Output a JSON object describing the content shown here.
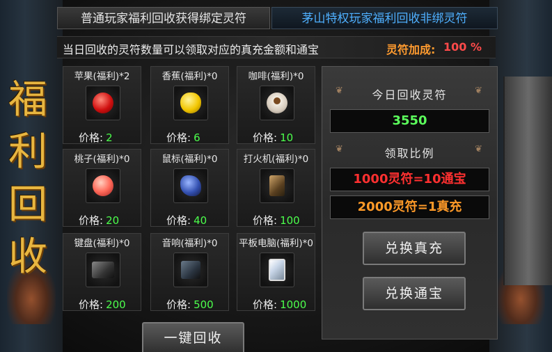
{
  "tabs": {
    "normal": "普通玩家福利回收获得绑定灵符",
    "vip": "茅山特权玩家福利回收非绑灵符"
  },
  "notice": {
    "text": "当日回收的灵符数量可以领取对应的真充金额和通宝",
    "bonus_label": "灵符加成:",
    "bonus_value": "100 %"
  },
  "side_title": [
    "福",
    "利",
    "回",
    "收"
  ],
  "price_label": "价格:",
  "items": [
    {
      "name": "苹果(福利)*2",
      "price": "2",
      "icon": "apple-icon"
    },
    {
      "name": "香蕉(福利)*0",
      "price": "6",
      "icon": "banana-icon"
    },
    {
      "name": "咖啡(福利)*0",
      "price": "10",
      "icon": "coffee-icon"
    },
    {
      "name": "桃子(福利)*0",
      "price": "20",
      "icon": "peach-icon"
    },
    {
      "name": "鼠标(福利)*0",
      "price": "40",
      "icon": "mouse-icon"
    },
    {
      "name": "打火机(福利)*0",
      "price": "100",
      "icon": "lighter-icon"
    },
    {
      "name": "键盘(福利)*0",
      "price": "200",
      "icon": "keyboard-icon"
    },
    {
      "name": "音响(福利)*0",
      "price": "500",
      "icon": "speaker-icon"
    },
    {
      "name": "平板电脑(福利)*0",
      "price": "1000",
      "icon": "tablet-icon"
    }
  ],
  "buttons": {
    "one_key": "一键回收",
    "exchange_cash": "兑换真充",
    "exchange_tongbao": "兑换通宝"
  },
  "right_panel": {
    "today_label": "今日回收灵符",
    "today_count": "3550",
    "ratio_label": "领取比例",
    "ratio_1": "1000灵符=10通宝",
    "ratio_2": "2000灵符=1真充"
  },
  "colors": {
    "price_value": "#4cff4c",
    "title_gold": "#e8b640",
    "ratio_red": "#ff3030",
    "ratio_orange": "#ff9a28",
    "vip_tab": "#4fb0ff"
  }
}
